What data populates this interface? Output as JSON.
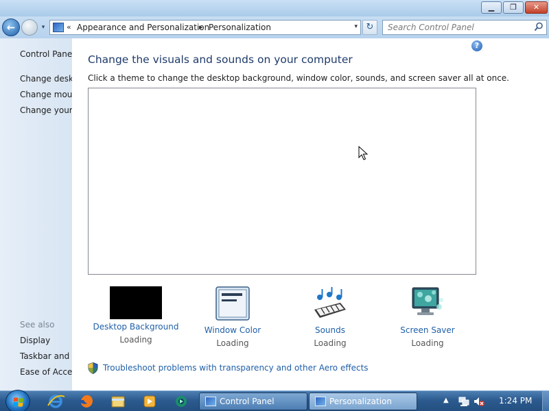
{
  "window": {
    "minimize_glyph": "▁",
    "maximize_glyph": "❐",
    "close_glyph": "✕"
  },
  "nav": {
    "back_glyph": "←",
    "history_glyph": "▾",
    "address": {
      "overflow": "«",
      "crumbs": [
        "Appearance and Personalization",
        "Personalization"
      ],
      "separator": "▸",
      "dropdown_glyph": "▾"
    },
    "refresh_glyph": "↻",
    "search_placeholder": "Search Control Panel"
  },
  "sidebar": {
    "home": "Control Panel",
    "tasks": [
      "Change deskto",
      "Change mouse",
      "Change your a"
    ],
    "see_also_label": "See also",
    "see_also": [
      "Display",
      "Taskbar and St",
      "Ease of Access"
    ]
  },
  "main": {
    "help_glyph": "?",
    "heading": "Change the visuals and sounds on your computer",
    "subtext": "Click a theme to change the desktop background, window color, sounds, and screen saver all at once.",
    "tiles": [
      {
        "label": "Desktop Background",
        "status": "Loading"
      },
      {
        "label": "Window Color",
        "status": "Loading"
      },
      {
        "label": "Sounds",
        "status": "Loading"
      },
      {
        "label": "Screen Saver",
        "status": "Loading"
      }
    ],
    "troubleshoot_link": "Troubleshoot problems with transparency and other Aero effects"
  },
  "taskbar": {
    "tasks": [
      {
        "label": "Control Panel",
        "active": false
      },
      {
        "label": "Personalization",
        "active": true
      }
    ],
    "tray_arrow": "▲",
    "clock": "1:24 PM"
  },
  "colors": {
    "link": "#1f5fa8",
    "heading": "#1e3a6a",
    "taskbar": "#2c5b8f"
  }
}
